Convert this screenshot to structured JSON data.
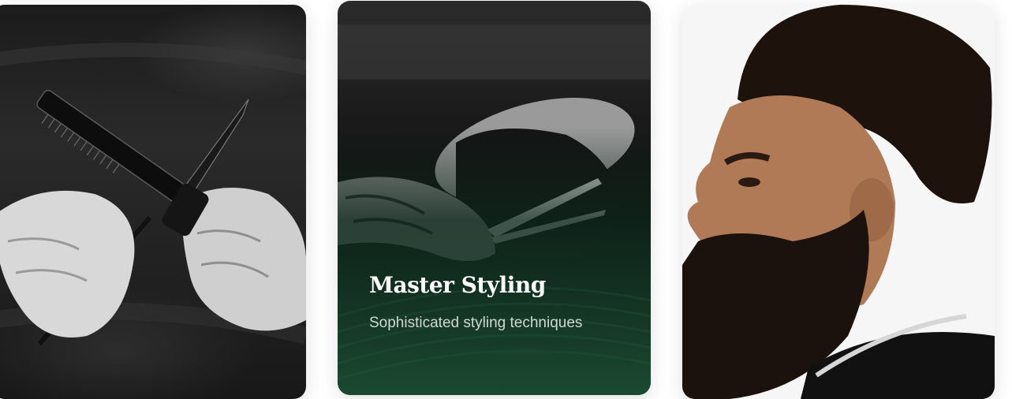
{
  "cards": [
    {
      "id": "tools",
      "photo": "comb-and-scissors-photo"
    },
    {
      "id": "styling",
      "photo": "beard-trim-photo",
      "title": "Master Styling",
      "description": "Sophisticated styling techniques"
    },
    {
      "id": "portrait",
      "photo": "bearded-man-portrait-photo"
    }
  ],
  "colors": {
    "overlay_green": "#1c4e34",
    "title_text": "#ffffff",
    "description_text": "#cfd8d2"
  }
}
